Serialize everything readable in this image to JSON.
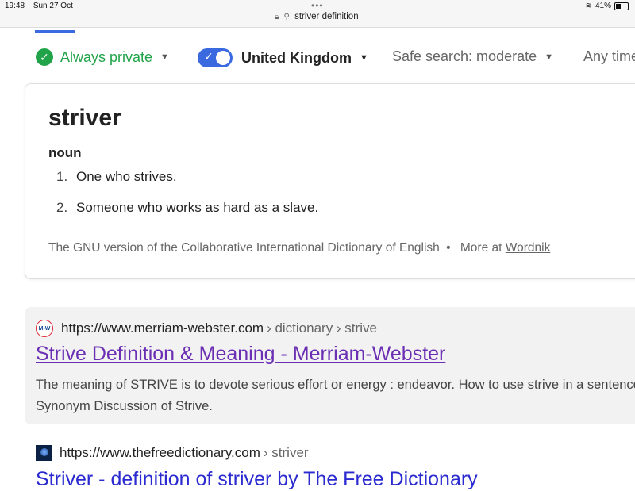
{
  "status": {
    "time": "19:48",
    "date": "Sun 27 Oct",
    "battery": "41%",
    "battery_level": 0.41,
    "url": "striver definition"
  },
  "filters": {
    "privacy": "Always private",
    "region": "United Kingdom",
    "safe_search": "Safe search: moderate",
    "time": "Any time"
  },
  "definition": {
    "word": "striver",
    "part_of_speech": "noun",
    "items": [
      {
        "num": "1.",
        "text": "One who strives."
      },
      {
        "num": "2.",
        "text": "Someone who works as hard as a slave."
      }
    ],
    "source": "The GNU version of the Collaborative International Dictionary of English",
    "more_prefix": "More at",
    "more_link": "Wordnik"
  },
  "results": [
    {
      "favicon": "M-W",
      "url": "https://www.merriam-webster.com",
      "crumbs": "› dictionary › strive",
      "title": "Strive Definition & Meaning - Merriam-Webster",
      "snippet": "The meaning of STRIVE is to devote serious effort or energy : endeavor. How to use strive in a sentence. Synonym Discussion of Strive."
    },
    {
      "url": "https://www.thefreedictionary.com",
      "crumbs": "› striver",
      "title": "Striver - definition of striver by The Free Dictionary"
    }
  ]
}
